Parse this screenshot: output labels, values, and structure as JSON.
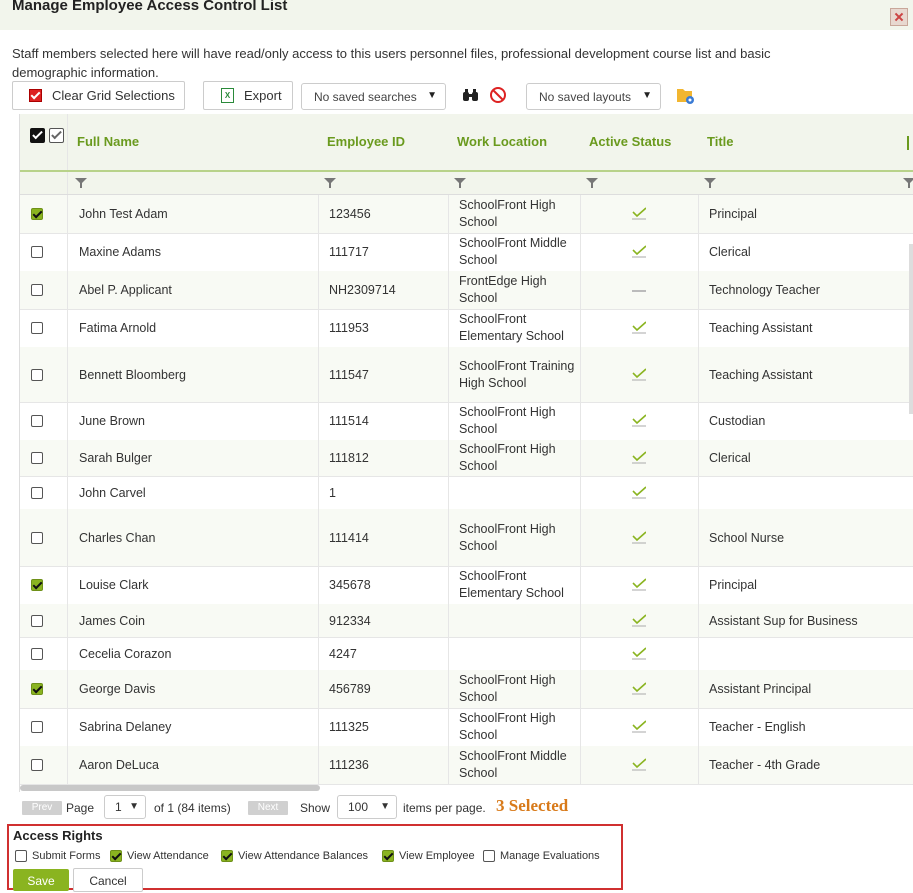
{
  "dialog": {
    "title": "Manage Employee Access Control List",
    "description": "Staff members selected here will have read/only access to this users personnel files, professional development course list and basic demographic information."
  },
  "toolbar": {
    "clear_label": "Clear Grid Selections",
    "export_label": "Export",
    "saved_searches": "No saved searches",
    "saved_layouts": "No saved layouts"
  },
  "grid": {
    "columns": [
      "Full Name",
      "Employee ID",
      "Work Location",
      "Active Status",
      "Title"
    ],
    "rows": [
      {
        "name": "John Test Adam",
        "id": "123456",
        "location": "SchoolFront High School",
        "active": true,
        "title": "Principal",
        "checked": true
      },
      {
        "name": "Maxine Adams",
        "id": "111717",
        "location": "SchoolFront Middle School",
        "active": true,
        "title": "Clerical",
        "checked": false
      },
      {
        "name": "Abel P. Applicant",
        "id": "NH2309714",
        "location": "FrontEdge High School",
        "active": false,
        "title": "Technology Teacher",
        "checked": false
      },
      {
        "name": "Fatima Arnold",
        "id": "111953",
        "location": "SchoolFront Elementary School",
        "active": true,
        "title": "Teaching Assistant",
        "checked": false
      },
      {
        "name": "Bennett Bloomberg",
        "id": "111547",
        "location": "SchoolFront Training High School",
        "active": true,
        "title": "Teaching Assistant",
        "checked": false
      },
      {
        "name": "June Brown",
        "id": "111514",
        "location": "SchoolFront High School",
        "active": true,
        "title": "Custodian",
        "checked": false
      },
      {
        "name": "Sarah Bulger",
        "id": "111812",
        "location": "SchoolFront High School",
        "active": true,
        "title": "Clerical",
        "checked": false
      },
      {
        "name": "John Carvel",
        "id": "1",
        "location": "",
        "active": true,
        "title": "",
        "checked": false
      },
      {
        "name": "Charles Chan",
        "id": "111414",
        "location": "SchoolFront High School",
        "active": true,
        "title": "School Nurse",
        "checked": false
      },
      {
        "name": "Louise Clark",
        "id": "345678",
        "location": "SchoolFront Elementary School",
        "active": true,
        "title": "Principal",
        "checked": true
      },
      {
        "name": "James Coin",
        "id": "912334",
        "location": "",
        "active": true,
        "title": "Assistant Sup for Business",
        "checked": false
      },
      {
        "name": "Cecelia Corazon",
        "id": "4247",
        "location": "",
        "active": true,
        "title": "",
        "checked": false
      },
      {
        "name": "George Davis",
        "id": "456789",
        "location": "SchoolFront High School",
        "active": true,
        "title": "Assistant Principal",
        "checked": true
      },
      {
        "name": "Sabrina Delaney",
        "id": "111325",
        "location": "SchoolFront High School",
        "active": true,
        "title": "Teacher - English",
        "checked": false
      },
      {
        "name": "Aaron DeLuca",
        "id": "111236",
        "location": "SchoolFront Middle School",
        "active": true,
        "title": "Teacher - 4th Grade",
        "checked": false
      }
    ]
  },
  "pager": {
    "prev": "Prev",
    "page_label": "Page",
    "page_value": "1",
    "of_text": "of 1 (84 items)",
    "next": "Next",
    "show_label": "Show",
    "page_size": "100",
    "per_page": "items per page.",
    "selected": "3 Selected"
  },
  "access_rights": {
    "title": "Access Rights",
    "items": [
      {
        "label": "Submit Forms",
        "checked": false
      },
      {
        "label": "View Attendance",
        "checked": true
      },
      {
        "label": "View Attendance Balances",
        "checked": true
      },
      {
        "label": "View Employee",
        "checked": true
      },
      {
        "label": "Manage Evaluations",
        "checked": false
      }
    ],
    "save": "Save",
    "cancel": "Cancel"
  },
  "colors": {
    "accent": "#8ab420",
    "header_text": "#6a9a1e",
    "selected_text": "#d87a1a",
    "highlight_border": "#d03030"
  },
  "icons": [
    "close-icon",
    "clear-checkbox-icon",
    "excel-icon",
    "chevron-down-icon",
    "binoculars-icon",
    "no-entry-icon",
    "folder-gear-icon",
    "filter-icon",
    "check-icon"
  ]
}
